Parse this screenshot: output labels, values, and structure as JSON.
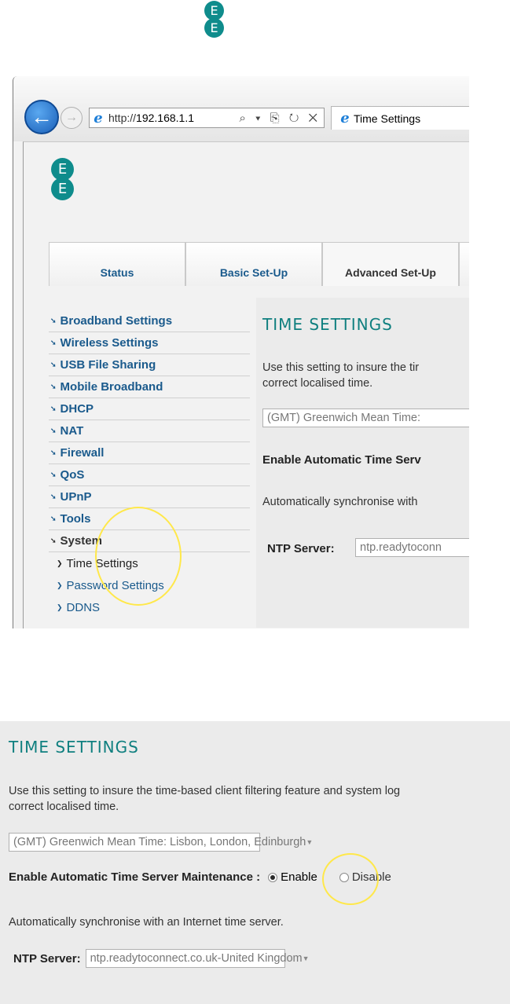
{
  "brand": {
    "logo_letters": [
      "E",
      "E"
    ],
    "brand_color": "#0f8c8c"
  },
  "browser": {
    "url_prefix": "http://",
    "url_host": "192.168.1.1",
    "address_tools": "⌕ ▾ ⎘ ↻ ✕",
    "tab_title": "Time Settings"
  },
  "nav": {
    "tabs": [
      {
        "label": "Status"
      },
      {
        "label": "Basic Set-Up"
      },
      {
        "label": "Advanced Set-Up",
        "active": true
      }
    ]
  },
  "sidebar": {
    "items": [
      {
        "label": "Broadband Settings"
      },
      {
        "label": "Wireless Settings"
      },
      {
        "label": "USB File Sharing"
      },
      {
        "label": "Mobile Broadband"
      },
      {
        "label": "DHCP"
      },
      {
        "label": "NAT"
      },
      {
        "label": "Firewall"
      },
      {
        "label": "QoS"
      },
      {
        "label": "UPnP"
      },
      {
        "label": "Tools"
      },
      {
        "label": "System"
      }
    ],
    "sub_items": [
      {
        "label": "Time Settings"
      },
      {
        "label": "Password Settings"
      },
      {
        "label": "DDNS"
      }
    ]
  },
  "time_settings": {
    "title": "TIME SETTINGS",
    "description_line1": "Use this setting to insure the time-based client filtering feature and system log",
    "description_line2": "correct localised time.",
    "description_line1_cropped": "Use this setting to insure the tir",
    "timezone_value": "(GMT) Greenwich Mean Time: Lisbon, London, Edinburgh",
    "timezone_value_cropped": "(GMT) Greenwich Mean Time:",
    "auto_label": "Enable Automatic Time Server Maintenance",
    "auto_label_cropped": "Enable Automatic Time Serv",
    "auto_separator": " :",
    "enable_label": "Enable",
    "disable_label": "Disable",
    "enabled": true,
    "sync_text": "Automatically synchronise with an Internet time server.",
    "sync_text_cropped": "Automatically synchronise with",
    "ntp_label": "NTP Server:",
    "ntp_value": "ntp.readytoconnect.co.uk-United Kingdom",
    "ntp_value_cropped": "ntp.readytoconn"
  },
  "colors": {
    "link": "#1a5a8c",
    "title": "#0f7f7f",
    "highlight": "#ffe84a"
  }
}
